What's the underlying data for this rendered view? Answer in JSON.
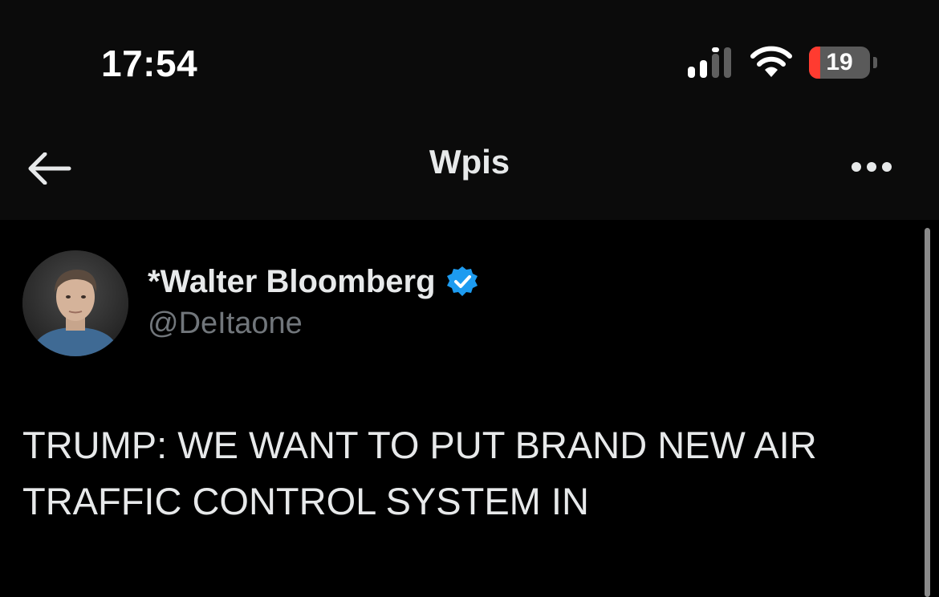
{
  "status_bar": {
    "time": "17:54",
    "battery_level": "19",
    "battery_fraction": 0.19,
    "signal_icon": "cellular-signal-icon",
    "wifi_icon": "wifi-icon",
    "battery_icon": "battery-icon"
  },
  "nav": {
    "back_icon": "arrow-left-icon",
    "title": "Wpis",
    "more_icon": "ellipsis-icon"
  },
  "tweet": {
    "author_name": "*Walter Bloomberg",
    "verified_icon": "verified-badge-icon",
    "handle": "@DeItaone",
    "text": "TRUMP: WE WANT TO PUT BRAND NEW AIR TRAFFIC CONTROL SYSTEM IN"
  },
  "colors": {
    "background": "#000000",
    "text_primary": "#e7e9ea",
    "text_secondary": "#71767b",
    "verified_blue": "#1d9bf0",
    "battery_low": "#ff3b30"
  }
}
